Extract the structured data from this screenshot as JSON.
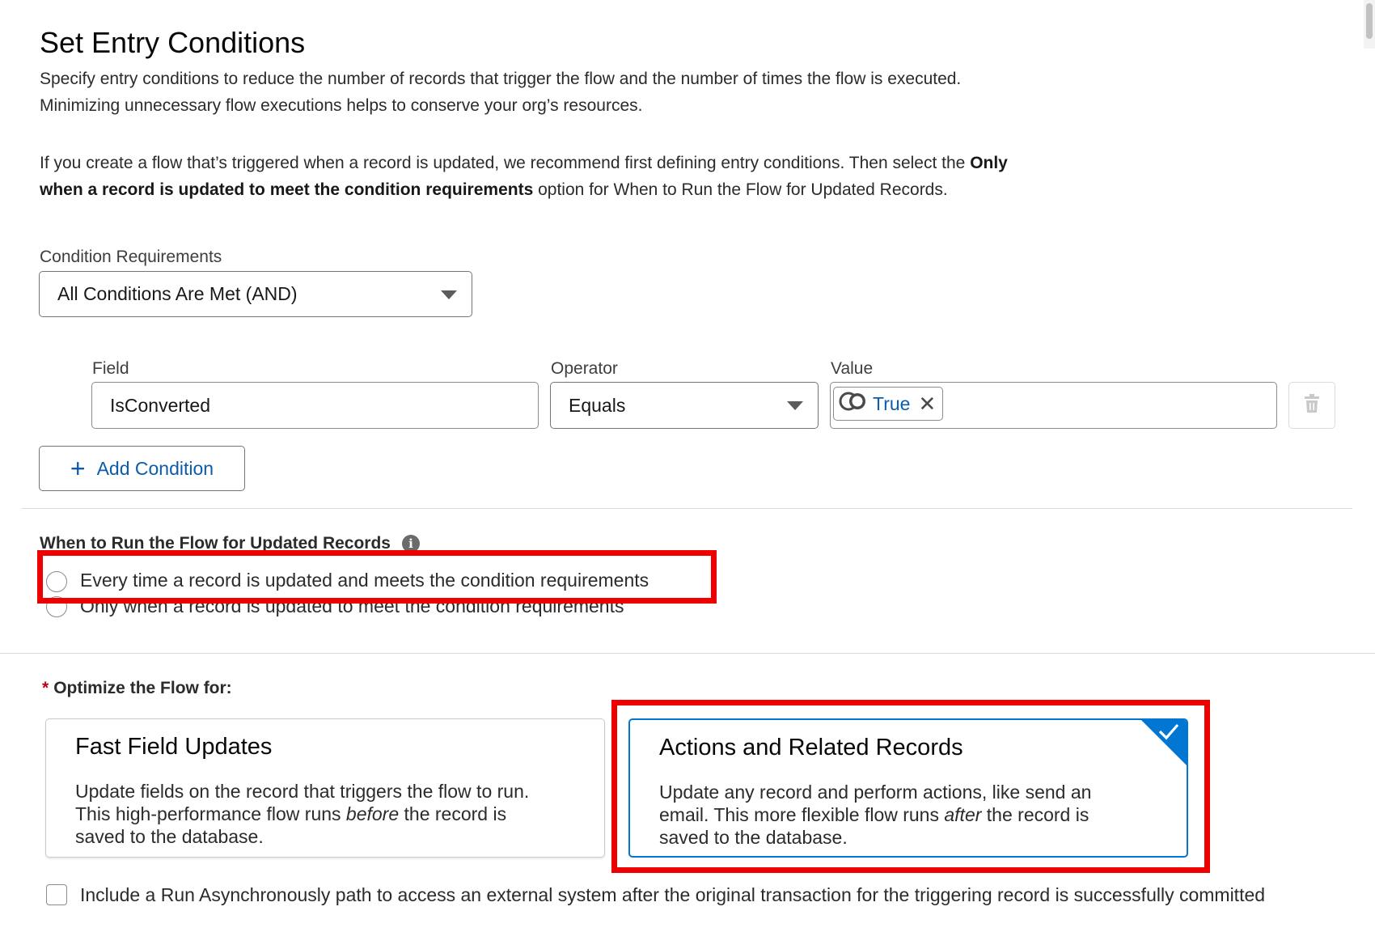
{
  "header": {
    "title": "Set Entry Conditions"
  },
  "intro": {
    "para1": "Specify entry conditions to reduce the number of records that trigger the flow and the number of times the flow is executed. Minimizing unnecessary flow executions helps to conserve your org’s resources.",
    "para2_before": "If you create a flow that’s triggered when a record is updated, we recommend first defining entry conditions. Then select the ",
    "para2_bold": "Only when a record is updated to meet the condition requirements",
    "para2_after": " option for When to Run the Flow for Updated Records."
  },
  "condition_requirements": {
    "label": "Condition Requirements",
    "selected": "All Conditions Are Met (AND)"
  },
  "condition_row": {
    "field_label": "Field",
    "field_value": "IsConverted",
    "operator_label": "Operator",
    "operator_value": "Equals",
    "value_label": "Value",
    "value_pill": "True",
    "value_icon": "boolean-icon",
    "delete_icon": "trash-icon"
  },
  "add_condition": {
    "label": "Add Condition",
    "icon": "plus-icon"
  },
  "when_to_run": {
    "label": "When to Run the Flow for Updated Records",
    "info_icon": "info-icon",
    "options": [
      {
        "label": "Every time a record is updated and meets the condition requirements",
        "checked": true
      },
      {
        "label": "Only when a record is updated to meet the condition requirements",
        "checked": false
      }
    ]
  },
  "optimize": {
    "required_marker": "*",
    "label": "Optimize the Flow for:",
    "cards": [
      {
        "title": "Fast Field Updates",
        "desc_before": "Update fields on the record that triggers the flow to run. This high-performance flow runs ",
        "desc_em": "before",
        "desc_after": " the record is saved to the database.",
        "selected": false
      },
      {
        "title": "Actions and Related Records",
        "desc_before": "Update any record and perform actions, like send an email. This more flexible flow runs ",
        "desc_em": "after",
        "desc_after": " the record is saved to the database.",
        "selected": true
      }
    ]
  },
  "async": {
    "label": "Include a Run Asynchronously path to access an external system after the original transaction for the triggering record is successfully committed",
    "checked": false
  },
  "colors": {
    "brand_blue": "#0176d3",
    "link_blue": "#0b5cab",
    "highlight_red": "#ee0000",
    "required_red": "#ba0517"
  }
}
